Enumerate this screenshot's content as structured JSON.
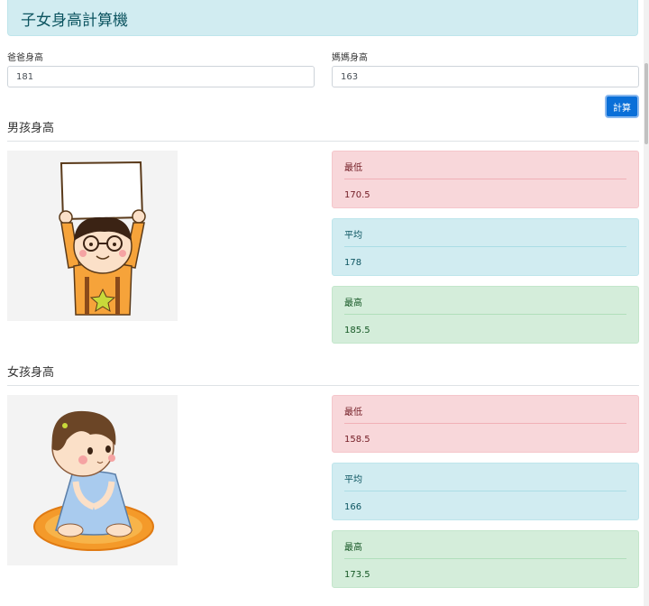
{
  "header": {
    "title": "子女身高計算機"
  },
  "form": {
    "father_label": "爸爸身高",
    "father_value": "181",
    "mother_label": "媽媽身高",
    "mother_value": "163",
    "calc_label": "計算"
  },
  "boy": {
    "title": "男孩身高",
    "image_icon": "boy-holding-sign-icon",
    "min_label": "最低",
    "min_value": "170.5",
    "avg_label": "平均",
    "avg_value": "178",
    "max_label": "最高",
    "max_value": "185.5"
  },
  "girl": {
    "title": "女孩身高",
    "image_icon": "girl-sitting-icon",
    "min_label": "最低",
    "min_value": "158.5",
    "avg_label": "平均",
    "avg_value": "166",
    "max_label": "最高",
    "max_value": "173.5"
  },
  "colors": {
    "header_bg": "#d1ecf1",
    "min_bg": "#f8d7da",
    "avg_bg": "#d1ecf1",
    "max_bg": "#d4edda",
    "button_bg": "#0a6fd8"
  }
}
